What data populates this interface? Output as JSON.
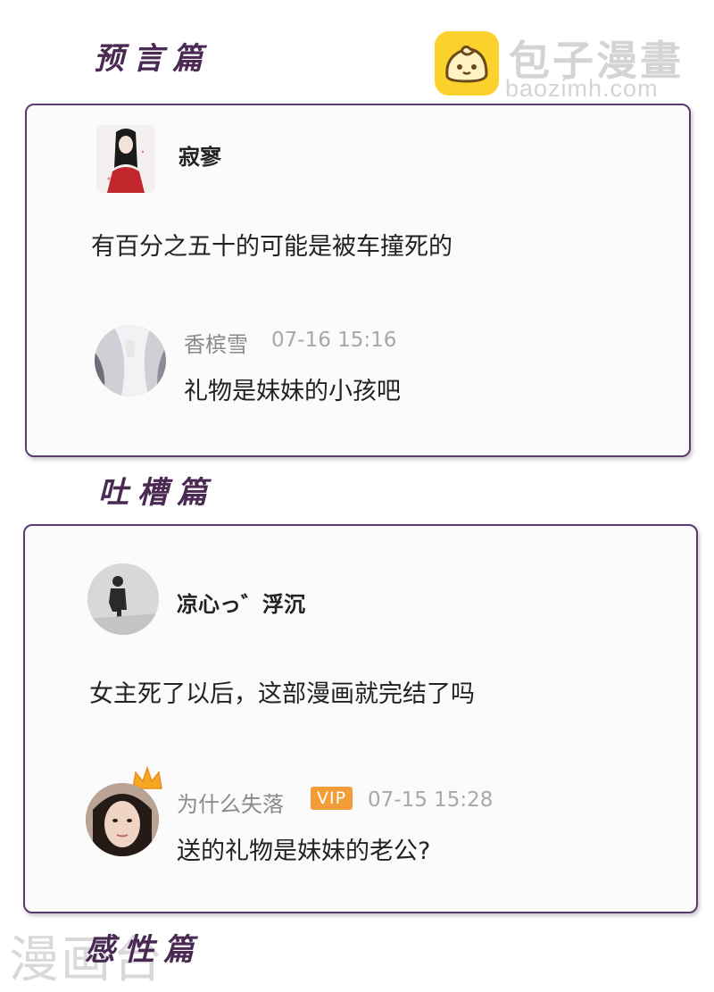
{
  "logo": {
    "icon": "bun-logo-icon",
    "name": "包子漫畫",
    "url": "baozimh.com"
  },
  "watermark": "漫画台",
  "sections": [
    {
      "title": "预言篇",
      "comment": {
        "author": "寂寥",
        "text": "有百分之五十的可能是被车撞死的",
        "reply": {
          "author": "香槟雪",
          "time": "07-16 15:16",
          "text": "礼物是妹妹的小孩吧"
        }
      }
    },
    {
      "title": "吐槽篇",
      "comment": {
        "author": "凉心っ゛浮沉",
        "text": "女主死了以后，这部漫画就完结了吗",
        "reply": {
          "author": "为什么失落",
          "badge": "VIP",
          "time": "07-15 15:28",
          "text": "送的礼物是妹妹的老公?"
        }
      }
    },
    {
      "title": "感性篇"
    }
  ],
  "colors": {
    "border": "#5b3b6e",
    "title": "#4a2a52",
    "vip": "#f29d38",
    "logo": "#fbd12b"
  }
}
